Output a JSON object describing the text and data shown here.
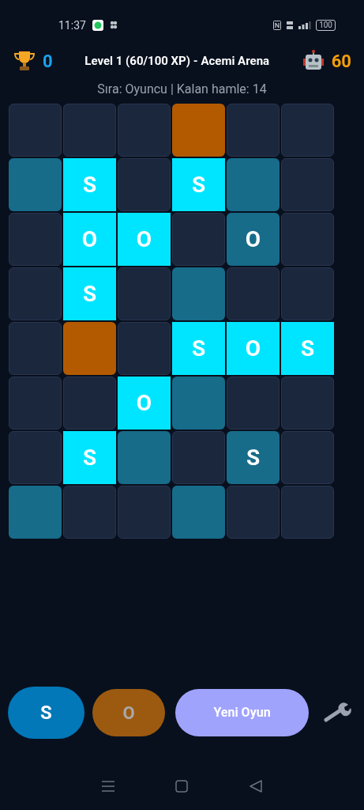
{
  "status_bar": {
    "time": "11:37",
    "battery": "100"
  },
  "header": {
    "player_score": "0",
    "title": "Level 1 (60/100 XP) - Acemi Arena",
    "bot_score": "60"
  },
  "turn_info": "Sıra: Oyuncu | Kalan hamle: 14",
  "board": [
    [
      {
        "kind": "empty"
      },
      {
        "kind": "empty"
      },
      {
        "kind": "empty"
      },
      {
        "kind": "blocked"
      },
      {
        "kind": "empty"
      },
      {
        "kind": "empty"
      }
    ],
    [
      {
        "kind": "hint"
      },
      {
        "kind": "sos",
        "letter": "S"
      },
      {
        "kind": "empty"
      },
      {
        "kind": "sos",
        "letter": "S"
      },
      {
        "kind": "hint"
      },
      {
        "kind": "empty"
      }
    ],
    [
      {
        "kind": "empty"
      },
      {
        "kind": "sos",
        "letter": "O"
      },
      {
        "kind": "sos",
        "letter": "O"
      },
      {
        "kind": "empty"
      },
      {
        "kind": "hint",
        "letter": "O"
      },
      {
        "kind": "empty"
      }
    ],
    [
      {
        "kind": "empty"
      },
      {
        "kind": "sos",
        "letter": "S"
      },
      {
        "kind": "empty"
      },
      {
        "kind": "hint"
      },
      {
        "kind": "empty"
      },
      {
        "kind": "empty"
      }
    ],
    [
      {
        "kind": "empty"
      },
      {
        "kind": "blocked"
      },
      {
        "kind": "empty"
      },
      {
        "kind": "sos",
        "letter": "S"
      },
      {
        "kind": "sos",
        "letter": "O"
      },
      {
        "kind": "sos",
        "letter": "S"
      }
    ],
    [
      {
        "kind": "empty"
      },
      {
        "kind": "empty"
      },
      {
        "kind": "sos",
        "letter": "O"
      },
      {
        "kind": "hint"
      },
      {
        "kind": "empty"
      },
      {
        "kind": "empty"
      }
    ],
    [
      {
        "kind": "empty"
      },
      {
        "kind": "sos",
        "letter": "S"
      },
      {
        "kind": "hint"
      },
      {
        "kind": "empty"
      },
      {
        "kind": "hint",
        "letter": "S"
      },
      {
        "kind": "empty"
      }
    ],
    [
      {
        "kind": "hint"
      },
      {
        "kind": "empty"
      },
      {
        "kind": "empty"
      },
      {
        "kind": "hint"
      },
      {
        "kind": "empty"
      },
      {
        "kind": "empty"
      }
    ]
  ],
  "letter_buttons": [
    {
      "label": "S",
      "selected": true
    },
    {
      "label": "O",
      "selected": false
    }
  ],
  "new_game_button": "Yeni Oyun"
}
